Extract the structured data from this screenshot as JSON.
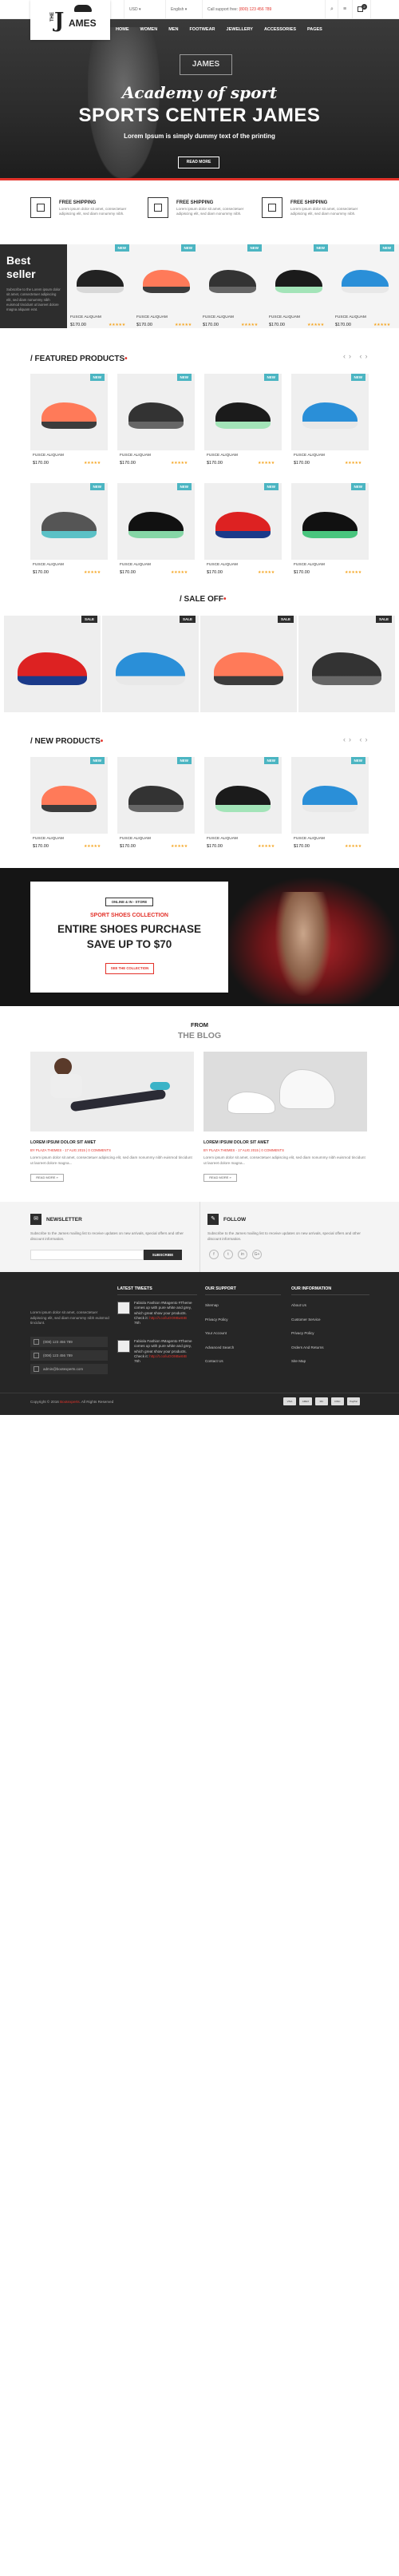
{
  "topbar": {
    "currency": "USD ▾",
    "language": "English ▾",
    "support_label": "Call support free:",
    "support_phone": "(800) 123 456 789",
    "cart_count": "2"
  },
  "logo": {
    "the": "THE",
    "j": "J",
    "ames": "AMES"
  },
  "nav": [
    "HOME",
    "WOMEN",
    "MEN",
    "FOOTWEAR",
    "JEWELLERY",
    "ACCESSORIES",
    "PAGES"
  ],
  "hero": {
    "badge": "JAMES",
    "script": "Academy of sport",
    "title": "SPORTS CENTER JAMES",
    "subtitle": "Lorem Ipsum is simply dummy text of the printing",
    "button": "READ MORE"
  },
  "shipping": [
    {
      "title": "FREE SHIPPING",
      "desc": "Lorem ipsum dolor sit amet, consectetuer adipiscing elit, sed diam nonummy nibh."
    },
    {
      "title": "FREE SHIPPING",
      "desc": "Lorem ipsum dolor sit amet, consectetuer adipiscing elit, sed diam nonummy nibh."
    },
    {
      "title": "FREE SHIPPING",
      "desc": "Lorem ipsum dolor sit amet, consectetuer adipiscing elit, sed diam nonummy nibh."
    }
  ],
  "best_seller": {
    "title_1": "Best",
    "title_2": "seller",
    "desc": "Subscribe to the Lorem ipsum dolor sit amet, consectetuer adipiscing elit, sed diam nonummy nibh euismod tincidunt ut laoreet dolore magna aliquam erat.",
    "badge": "NEW",
    "items": [
      {
        "name": "FUSCE ALIQUAM",
        "price": "$170.00",
        "stars": "★★★★★"
      },
      {
        "name": "FUSCE ALIQUAM",
        "price": "$170.00",
        "stars": "★★★★★"
      },
      {
        "name": "FUSCE ALIQUAM",
        "price": "$170.00",
        "stars": "★★★★★"
      },
      {
        "name": "FUSCE ALIQUAM",
        "price": "$170.00",
        "stars": "★★★★★"
      },
      {
        "name": "FUSCE ALIQUAM",
        "price": "$170.00",
        "stars": "★★★★★"
      }
    ]
  },
  "featured": {
    "title": "/ FEATURED PRODUCTS",
    "badge": "NEW",
    "items": [
      {
        "name": "FUSCE ALIQUAM",
        "price": "$170.00",
        "stars": "★★★★★"
      },
      {
        "name": "FUSCE ALIQUAM",
        "price": "$170.00",
        "stars": "★★★★★"
      },
      {
        "name": "FUSCE ALIQUAM",
        "price": "$170.00",
        "stars": "★★★★★"
      },
      {
        "name": "FUSCE ALIQUAM",
        "price": "$170.00",
        "stars": "★★★★★"
      },
      {
        "name": "FUSCE ALIQUAM",
        "price": "$170.00",
        "stars": "★★★★★"
      },
      {
        "name": "FUSCE ALIQUAM",
        "price": "$170.00",
        "stars": "★★★★★"
      },
      {
        "name": "FUSCE ALIQUAM",
        "price": "$170.00",
        "stars": "★★★★★"
      },
      {
        "name": "FUSCE ALIQUAM",
        "price": "$170.00",
        "stars": "★★★★★"
      }
    ]
  },
  "sale_off": {
    "title": "/ SALE OFF",
    "badge": "SALE"
  },
  "new_products": {
    "title": "/ NEW PRODUCTS",
    "badge": "NEW",
    "items": [
      {
        "name": "FUSCE ALIQUAM",
        "price": "$170.00",
        "stars": "★★★★★"
      },
      {
        "name": "FUSCE ALIQUAM",
        "price": "$170.00",
        "stars": "★★★★★"
      },
      {
        "name": "FUSCE ALIQUAM",
        "price": "$170.00",
        "stars": "★★★★★"
      },
      {
        "name": "FUSCE ALIQUAM",
        "price": "$170.00",
        "stars": "★★★★★"
      }
    ]
  },
  "promo": {
    "tag": "ONLINE & IN - STORE",
    "line1": "SPORT SHOES COLLECTION",
    "line2": "ENTIRE SHOES PURCHASE",
    "line3": "SAVE UP TO $70",
    "button": "SEE THE COLLECTION"
  },
  "blog": {
    "from": "FROM",
    "title": "THE BLOG",
    "posts": [
      {
        "title": "LOREM IPSUM DOLOR SIT AMET",
        "meta": "BY PLAZA THEMES - 17 AUG 2015 | 0 COMMENTS",
        "desc": "Lorem ipsum dolor sit amet, consectetuer adipiscing elit, sed diam nonummy nibh euismod tincidunt ut laoreet dolore magna...",
        "button": "READ MORE »"
      },
      {
        "title": "LOREM IPSUM DOLOR SIT AMET",
        "meta": "BY PLAZA THEMES - 17 AUG 2015 | 0 COMMENTS",
        "desc": "Lorem ipsum dolor sit amet, consectetuer adipiscing elit, sed diam nonummy nibh euismod tincidunt ut laoreet dolore magna...",
        "button": "READ MORE »"
      }
    ]
  },
  "newsletter": {
    "title": "NEWSLETTER",
    "desc": "Subscribe to the James mailing list to receive updates on new arrivals, special offers and other discount information.",
    "button": "SUBSCRIBE"
  },
  "follow": {
    "title": "FOLLOW",
    "desc": "Subscribe to the James mailing list to receive updates on new arrivals, special offers and other discount information.",
    "icons": [
      "f",
      "t",
      "in",
      "G+"
    ]
  },
  "footer": {
    "about": "Lorem ipsum dolor sit amet, consectetuer adipiscing elit, sed diam nonummy nibh euismod tincidunt.",
    "contacts": [
      "(008) 123 456 789",
      "(008) 123 456 789",
      "admin@bootexperts.com"
    ],
    "tweets_title": "LATEST TWEETS",
    "tweets": [
      {
        "text": "Fabiola Fashion #Magento #Theme comes up with pure white and grey, which great show your products. Check it:",
        "link": "http://t.co/luOO9Bw6IB",
        "time": "76h"
      },
      {
        "text": "Fabiola Fashion #Magento #Theme comes up with pure white and grey, which great show your products. Check it:",
        "link": "http://t.co/luOO9Bw6IB",
        "time": "76h"
      }
    ],
    "support_title": "OUR SUPPORT",
    "support": [
      "Sitemap",
      "Privacy Policy",
      "Your Account",
      "Advanced Search",
      "Contact Us"
    ],
    "info_title": "OUR INFORMATION",
    "info": [
      "About Us",
      "Customer Service",
      "Privacy Policy",
      "Orders And Returns",
      "Site Map"
    ],
    "copyright_pre": "Copyright © 2016",
    "copyright_brand": "Bootexperts",
    "copyright_post": ". All Rights Reserved",
    "payments": [
      "VISA",
      "AMEX",
      "MC",
      "DISC",
      "PayPal"
    ]
  },
  "colors": {
    "accent": "#e3322a",
    "badge_new": "#4bb5c2",
    "dark": "#2d2d2d"
  }
}
